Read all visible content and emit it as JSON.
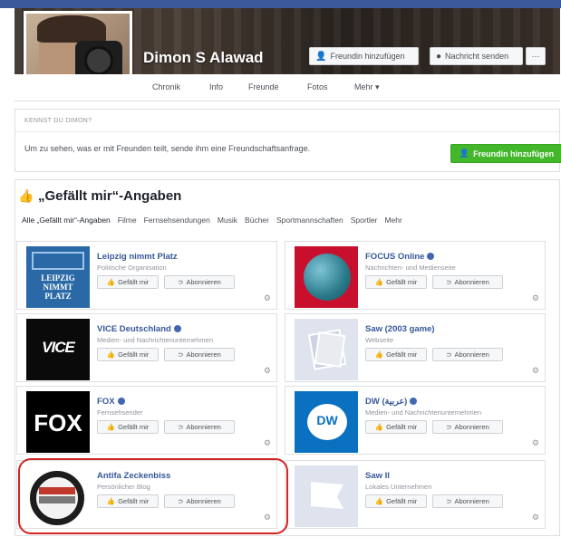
{
  "profile": {
    "name": "Dimon S Alawad",
    "add_friend_label": "Freundin hinzufügen",
    "message_label": "Nachricht senden",
    "more_label": "···"
  },
  "nav": {
    "items": [
      "Chronik",
      "Info",
      "Freunde",
      "Fotos",
      "Mehr ▾"
    ]
  },
  "know": {
    "title": "KENNST DU DIMON?",
    "text": "Um zu sehen, was er mit Freunden teilt, sende ihm eine Freundschaftsanfrage.",
    "button_label": "Freundin hinzufügen"
  },
  "likes": {
    "title": "„Gefällt mir“-Angaben",
    "tabs": [
      "Alle „Gefällt mir“-Angaben",
      "Filme",
      "Fernsehsendungen",
      "Musik",
      "Bücher",
      "Sportmannschaften",
      "Sportler",
      "Mehr"
    ],
    "like_label": "Gefällt mir",
    "subscribe_label": "Abonnieren",
    "items": [
      {
        "name": "Leipzig nimmt Platz",
        "category": "Politische Organisation",
        "verified": false
      },
      {
        "name": "FOCUS Online",
        "category": "Nachrichten- und Medienseite",
        "verified": true
      },
      {
        "name": "VICE Deutschland",
        "category": "Medien- und Nachrichtenunternehmen",
        "verified": true
      },
      {
        "name": "Saw (2003 game)",
        "category": "Webseite",
        "verified": false
      },
      {
        "name": "FOX",
        "category": "Fernsehsender",
        "verified": true
      },
      {
        "name": "DW (عربية)",
        "category": "Medien- und Nachrichtenunternehmen",
        "verified": true
      },
      {
        "name": "Antifa Zeckenbiss",
        "category": "Persönlicher Blog",
        "verified": false
      },
      {
        "name": "Saw II",
        "category": "Lokales Unternehmen",
        "verified": false
      }
    ]
  },
  "thumbnails": {
    "leipzig_text": "LEIPZIG NIMMT PLATZ",
    "vice_text": "VICE",
    "fox_text": "FOX",
    "dw_text": "DW"
  },
  "colors": {
    "facebook_blue": "#3b5998",
    "green_button": "#42b72a",
    "highlight_red": "#d62222",
    "link": "#365899"
  }
}
